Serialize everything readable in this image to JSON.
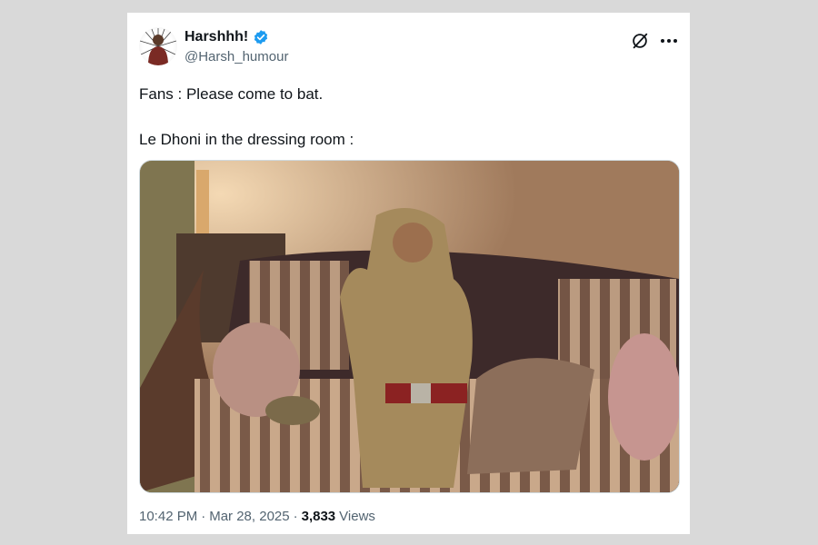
{
  "author": {
    "display_name": "Harshhh!",
    "handle": "@Harsh_humour",
    "verified": true
  },
  "icons": {
    "avatar": "profile-avatar",
    "verified": "verified-badge-icon",
    "grok": "grok-icon",
    "more": "more-options-icon"
  },
  "colors": {
    "accent": "#1d9bf0",
    "secondary_text": "#536471",
    "primary_text": "#0f1419"
  },
  "tweet": {
    "line1": "Fans : Please come to bat.",
    "line2": "Le Dhoni in the dressing room :"
  },
  "meta": {
    "time": "10:42 PM",
    "sep1": "·",
    "date": "Mar 28, 2025",
    "sep2": "·",
    "views_count": "3,833",
    "views_label": "Views"
  }
}
